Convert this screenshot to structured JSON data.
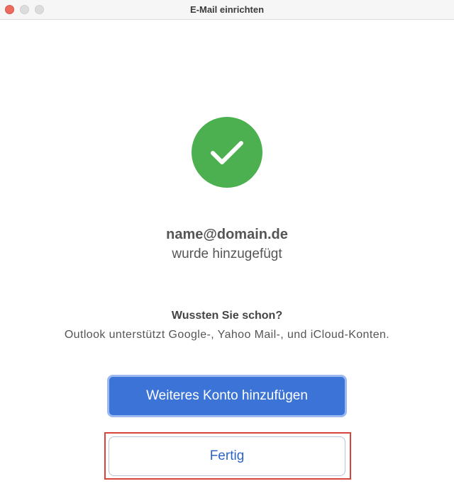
{
  "window": {
    "title": "E-Mail einrichten"
  },
  "success": {
    "icon": "checkmark-icon",
    "color": "#4caf50",
    "email": "name@domain.de",
    "message": "wurde hinzugefügt"
  },
  "tip": {
    "title": "Wussten Sie schon?",
    "text": "Outlook unterstützt Google-, Yahoo Mail-, und iCloud-Konten."
  },
  "buttons": {
    "add_account_label": "Weiteres Konto hinzufügen",
    "done_label": "Fertig"
  },
  "colors": {
    "primary": "#3b74d6",
    "highlight": "#d9443a"
  }
}
